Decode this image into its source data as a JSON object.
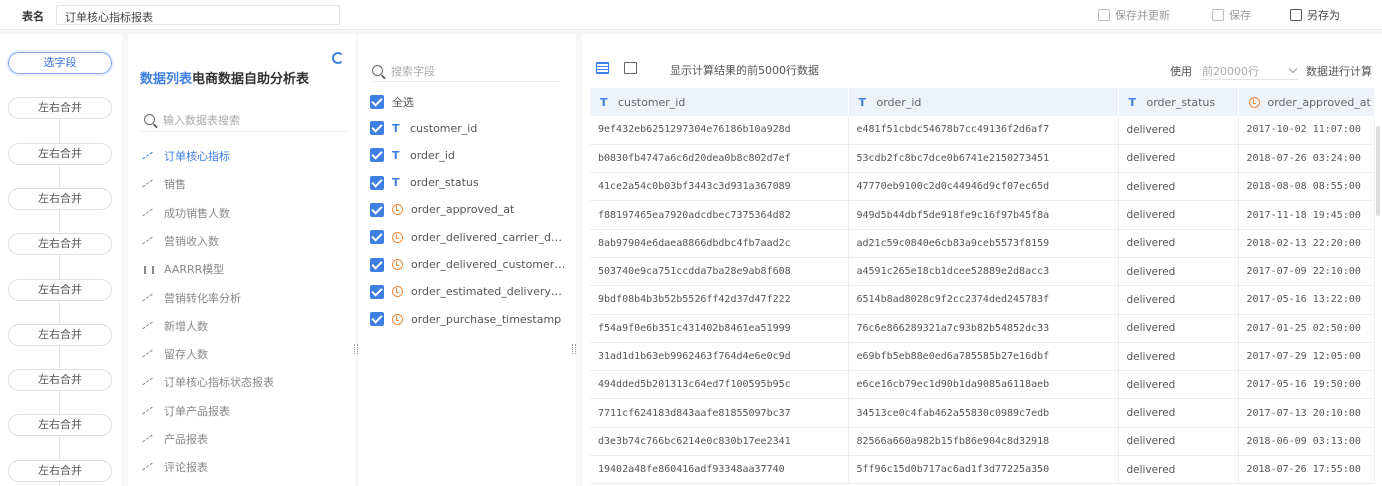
{
  "topbar": {
    "label": "表名",
    "table_name": "订单核心指标报表",
    "save_update_label": "保存并更新",
    "save_label": "保存",
    "save_as_label": "另存为"
  },
  "flow": {
    "nodes": [
      {
        "label": "选字段",
        "active": true
      },
      {
        "label": "左右合并"
      },
      {
        "label": "左右合并"
      },
      {
        "label": "左右合并"
      },
      {
        "label": "左右合并"
      },
      {
        "label": "左右合并"
      },
      {
        "label": "左右合并"
      },
      {
        "label": "左右合并"
      },
      {
        "label": "左右合并"
      },
      {
        "label": "左右合并"
      }
    ]
  },
  "fieldcol": {
    "title_prefix": "数据列表",
    "title_rest": "电商数据自助分析表",
    "search_placeholder": "输入数据表搜索",
    "items": [
      {
        "label": "订单核心指标",
        "active": true
      },
      {
        "label": "销售"
      },
      {
        "label": "成功销售人数"
      },
      {
        "label": "营销收入数"
      },
      {
        "label": "AARRR模型"
      },
      {
        "label": "营销转化率分析"
      },
      {
        "label": "新增人数"
      },
      {
        "label": "留存人数"
      },
      {
        "label": "订单核心指标状态报表"
      },
      {
        "label": "订单产品报表"
      },
      {
        "label": "产品报表"
      },
      {
        "label": "评论报表"
      }
    ]
  },
  "colpick": {
    "search_placeholder": "搜索字段",
    "select_all_label": "全选",
    "columns": [
      {
        "type": "T",
        "label": "customer_id"
      },
      {
        "type": "T",
        "label": "order_id"
      },
      {
        "type": "T",
        "label": "order_status"
      },
      {
        "type": "time",
        "label": "order_approved_at"
      },
      {
        "type": "time",
        "label": "order_delivered_carrier_date"
      },
      {
        "type": "time",
        "label": "order_delivered_customer_date"
      },
      {
        "type": "time",
        "label": "order_estimated_delivery_date"
      },
      {
        "type": "time",
        "label": "order_purchase_timestamp"
      }
    ]
  },
  "preview": {
    "info_text": "显示计算结果的前5000行数据",
    "use_label": "使用",
    "rows_select_value": "前20000行",
    "calc_label": "数据进行计算",
    "headers": [
      {
        "type": "T",
        "label": "customer_id"
      },
      {
        "type": "T",
        "label": "order_id"
      },
      {
        "type": "T",
        "label": "order_status"
      },
      {
        "type": "time",
        "label": "order_approved_at"
      }
    ],
    "rows": [
      [
        "9ef432eb6251297304e76186b10a928d",
        "e481f51cbdc54678b7cc49136f2d6af7",
        "delivered",
        "2017-10-02 11:07:00"
      ],
      [
        "b0830fb4747a6c6d20dea0b8c802d7ef",
        "53cdb2fc8bc7dce0b6741e2150273451",
        "delivered",
        "2018-07-26 03:24:00"
      ],
      [
        "41ce2a54c0b03bf3443c3d931a367089",
        "47770eb9100c2d0c44946d9cf07ec65d",
        "delivered",
        "2018-08-08 08:55:00"
      ],
      [
        "f88197465ea7920adcdbec7375364d82",
        "949d5b44dbf5de918fe9c16f97b45f8a",
        "delivered",
        "2017-11-18 19:45:00"
      ],
      [
        "8ab97904e6daea8866dbdbc4fb7aad2c",
        "ad21c59c0840e6cb83a9ceb5573f8159",
        "delivered",
        "2018-02-13 22:20:00"
      ],
      [
        "503740e9ca751ccdda7ba28e9ab8f608",
        "a4591c265e18cb1dcee52889e2d8acc3",
        "delivered",
        "2017-07-09 22:10:00"
      ],
      [
        "9bdf08b4b3b52b5526ff42d37d47f222",
        "6514b8ad8028c9f2cc2374ded245783f",
        "delivered",
        "2017-05-16 13:22:00"
      ],
      [
        "f54a9f0e6b351c431402b8461ea51999",
        "76c6e866289321a7c93b82b54852dc33",
        "delivered",
        "2017-01-25 02:50:00"
      ],
      [
        "31ad1d1b63eb9962463f764d4e6e0c9d",
        "e69bfb5eb88e0ed6a785585b27e16dbf",
        "delivered",
        "2017-07-29 12:05:00"
      ],
      [
        "494dded5b201313c64ed7f100595b95c",
        "e6ce16cb79ec1d90b1da9085a6118aeb",
        "delivered",
        "2017-05-16 19:50:00"
      ],
      [
        "7711cf624183d843aafe81855097bc37",
        "34513ce0c4fab462a55830c0989c7edb",
        "delivered",
        "2017-07-13 20:10:00"
      ],
      [
        "d3e3b74c766bc6214e0c830b17ee2341",
        "82566a660a982b15fb86e904c8d32918",
        "delivered",
        "2018-06-09 03:13:00"
      ],
      [
        "19402a48fe860416adf93348aa37740",
        "5ff96c15d0b717ac6ad1f3d77225a350",
        "delivered",
        "2018-07-26 17:55:00"
      ]
    ]
  },
  "colors": {
    "accent": "#3e7fe3",
    "time_icon": "#f08a3c",
    "header_bg": "#eef2f9"
  }
}
